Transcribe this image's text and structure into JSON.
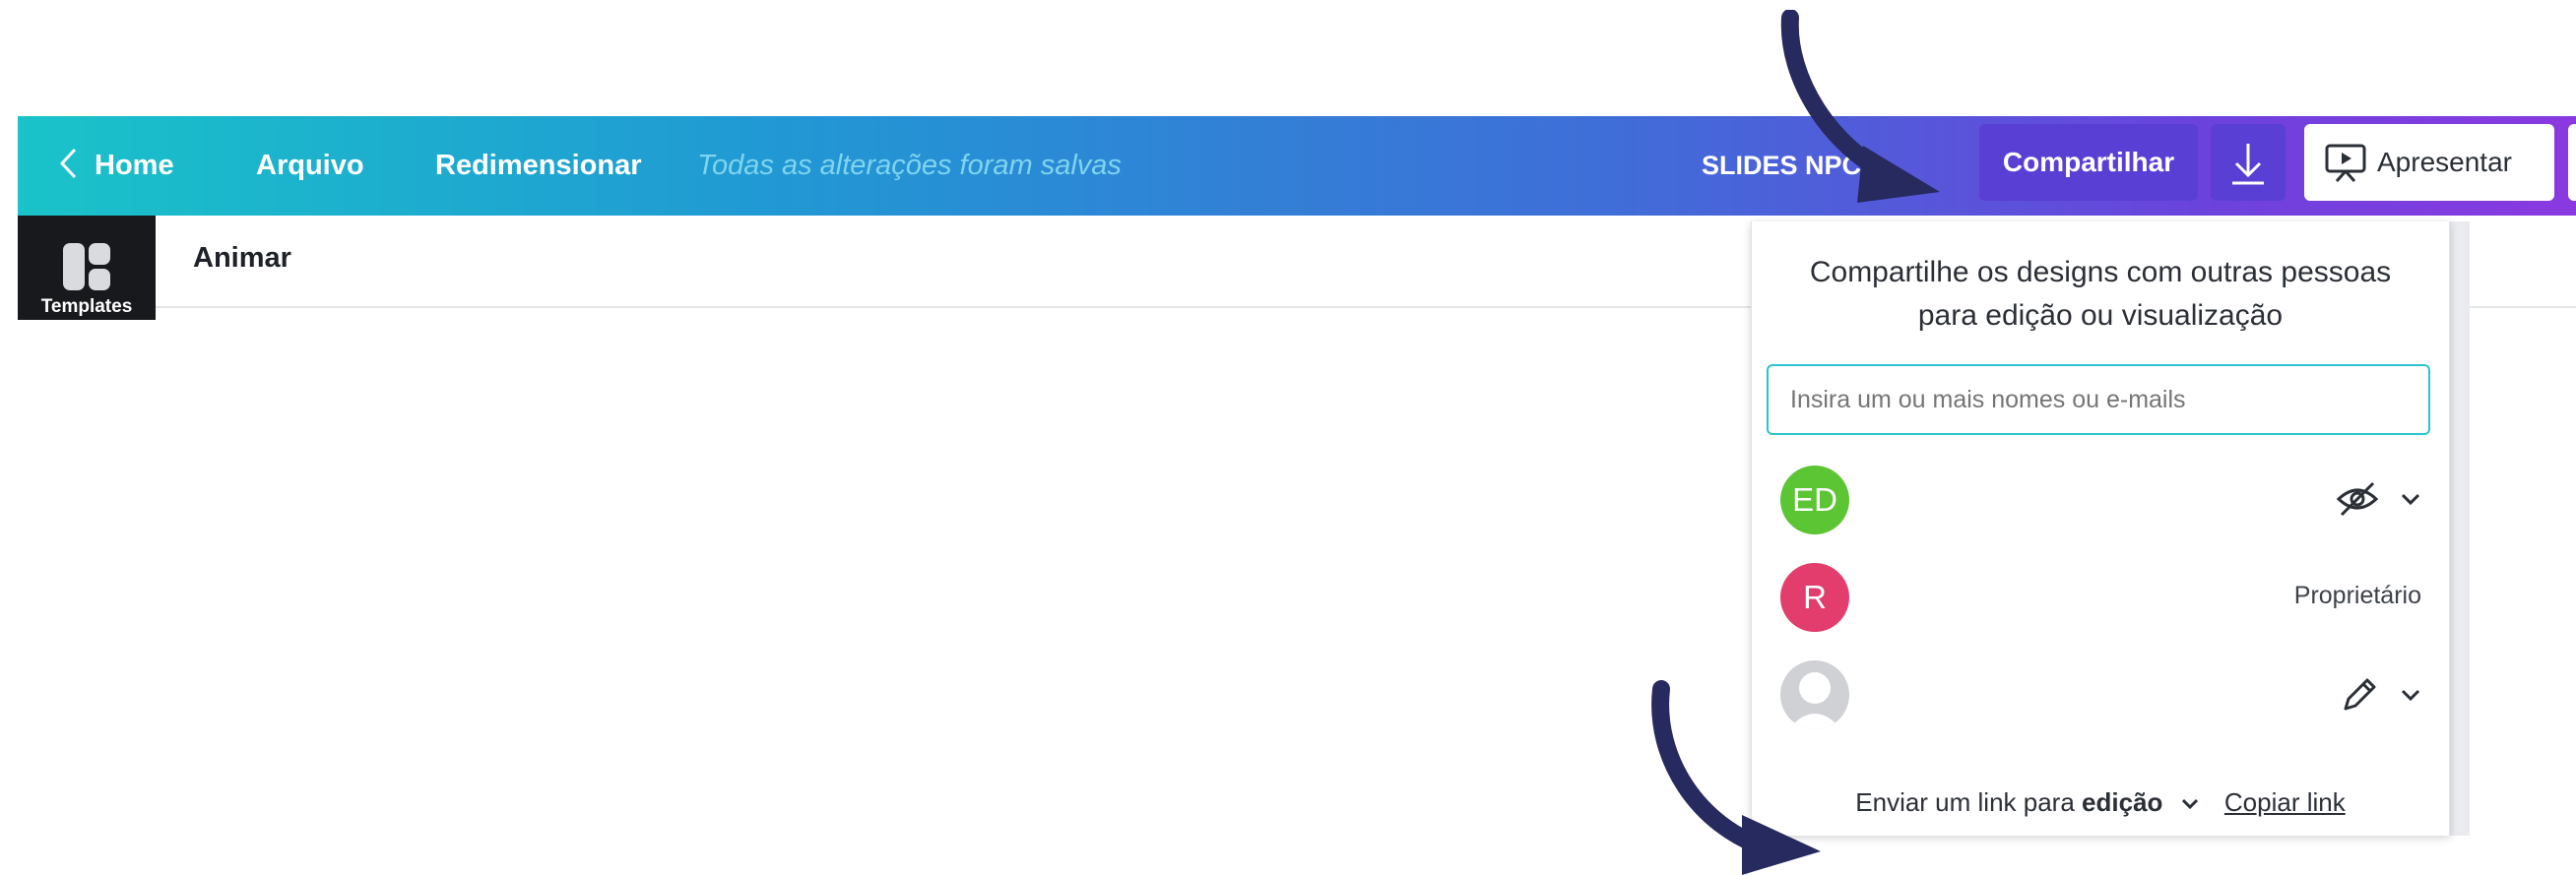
{
  "topbar": {
    "home_label": "Home",
    "file_label": "Arquivo",
    "resize_label": "Redimensionar",
    "save_status": "Todas as alterações foram salvas",
    "design_title": "SLIDES NPCD",
    "share_label": "Compartilhar",
    "present_label": "Apresentar"
  },
  "subbar": {
    "templates_label": "Templates",
    "animate_label": "Animar"
  },
  "share_panel": {
    "title_line1": "Compartilhe os designs com outras pessoas",
    "title_line2": "para edição ou visualização",
    "input_placeholder": "Insira um ou mais nomes ou e-mails",
    "users": [
      {
        "initials": "ED",
        "color": "#5cc534",
        "role_icon": "eye-off-icon"
      },
      {
        "initials": "R",
        "color": "#e23d6c",
        "role": "Proprietário"
      },
      {
        "initials": "",
        "color": "#cfd1d4",
        "role_icon": "pencil-icon"
      }
    ],
    "link_prefix": "Enviar um link para",
    "link_mode": "edição",
    "copy_link": "Copiar link"
  },
  "colors": {
    "accent_teal": "#19c3c9",
    "accent_purple": "#5a3fd4",
    "arrow_navy": "#262a5e"
  }
}
